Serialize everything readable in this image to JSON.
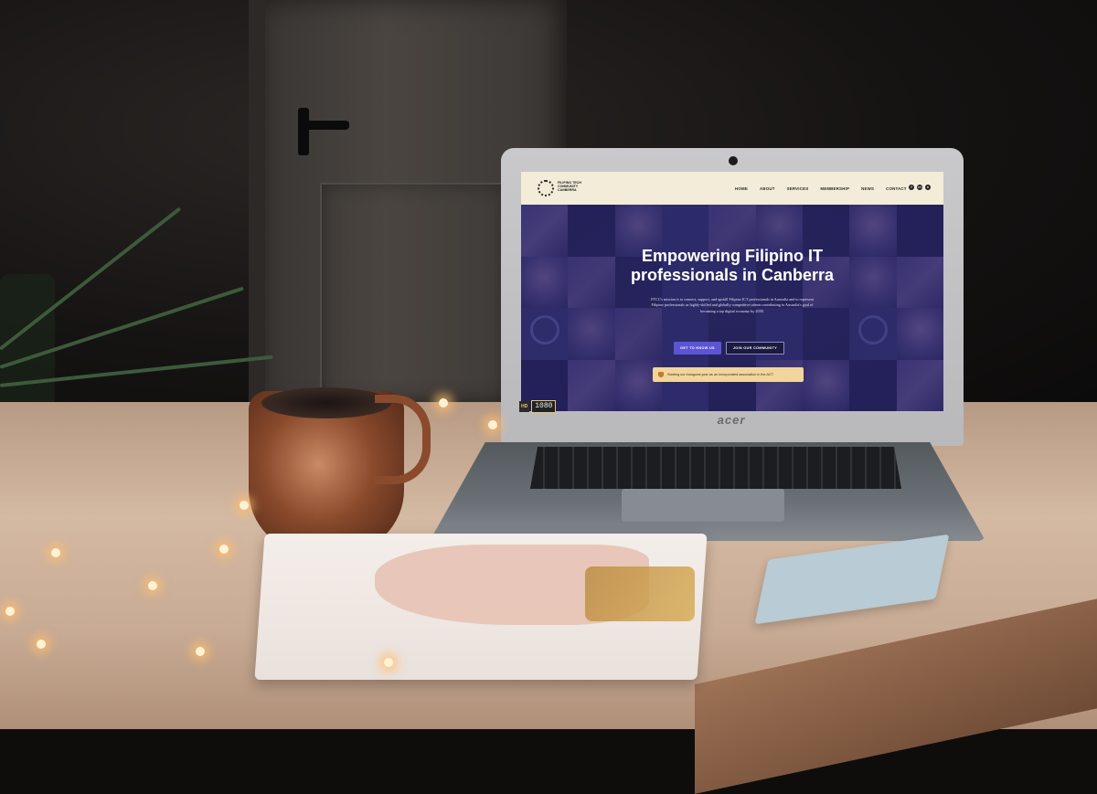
{
  "laptop": {
    "brand": "acer"
  },
  "video_badge": {
    "hd_label": "HD",
    "resolution": "1080"
  },
  "website": {
    "logo_text": "FILIPINO TECH\nCOMMUNITY\nCANBERRA",
    "nav": [
      "HOME",
      "ABOUT",
      "SERVICES",
      "MEMBERSHIP",
      "NEWS",
      "CONTACT"
    ],
    "social_icons": [
      "facebook-icon",
      "linkedin-icon",
      "github-icon"
    ],
    "hero": {
      "title": "Empowering Filipino IT professionals in Canberra",
      "body": "FTCC's mission is to connect, support, and upskill Filipino ICT professionals in Australia and to represent Filipino professionals as highly-skilled and globally competitive talents contributing to Australia's goal of becoming a top digital economy by 2030.",
      "primary_button": "GET TO KNOW US",
      "secondary_button": "JOIN OUR COMMUNITY",
      "notice": "Starting our inaugural year as an incorporated association in the ACT"
    },
    "colors": {
      "header_bg": "#f2ecd8",
      "hero_bg": "#2b2963",
      "primary_button": "#5b55d6",
      "notice_bg": "#f2d59c"
    }
  }
}
